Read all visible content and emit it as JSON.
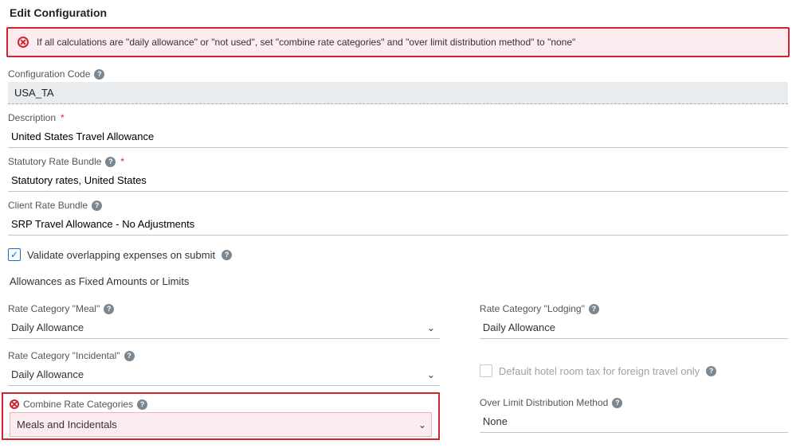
{
  "page": {
    "title": "Edit Configuration"
  },
  "error_banner": {
    "message": "If all calculations are \"daily allowance\" or \"not used\", set \"combine rate categories\" and \"over limit distribution method\" to \"none\""
  },
  "fields": {
    "config_code": {
      "label": "Configuration Code",
      "value": "USA_TA"
    },
    "description": {
      "label": "Description",
      "value": "United States Travel Allowance"
    },
    "statutory_bundle": {
      "label": "Statutory Rate Bundle",
      "value": "Statutory rates, United States"
    },
    "client_bundle": {
      "label": "Client Rate Bundle",
      "value": "SRP Travel Allowance - No Adjustments"
    }
  },
  "checkboxes": {
    "validate_overlap": {
      "label": "Validate overlapping expenses on submit",
      "checked": true
    },
    "hotel_tax": {
      "label": "Default hotel room tax for foreign travel only",
      "checked": false
    }
  },
  "allowances": {
    "section_title": "Allowances as Fixed Amounts or Limits",
    "meal": {
      "label": "Rate Category \"Meal\"",
      "value": "Daily Allowance"
    },
    "lodging": {
      "label": "Rate Category \"Lodging\"",
      "value": "Daily Allowance"
    },
    "incidental": {
      "label": "Rate Category \"Incidental\"",
      "value": "Daily Allowance"
    },
    "combine": {
      "label": "Combine Rate Categories",
      "value": "Meals and Incidentals"
    },
    "over_limit": {
      "label": "Over Limit Distribution Method",
      "value": "None"
    }
  }
}
